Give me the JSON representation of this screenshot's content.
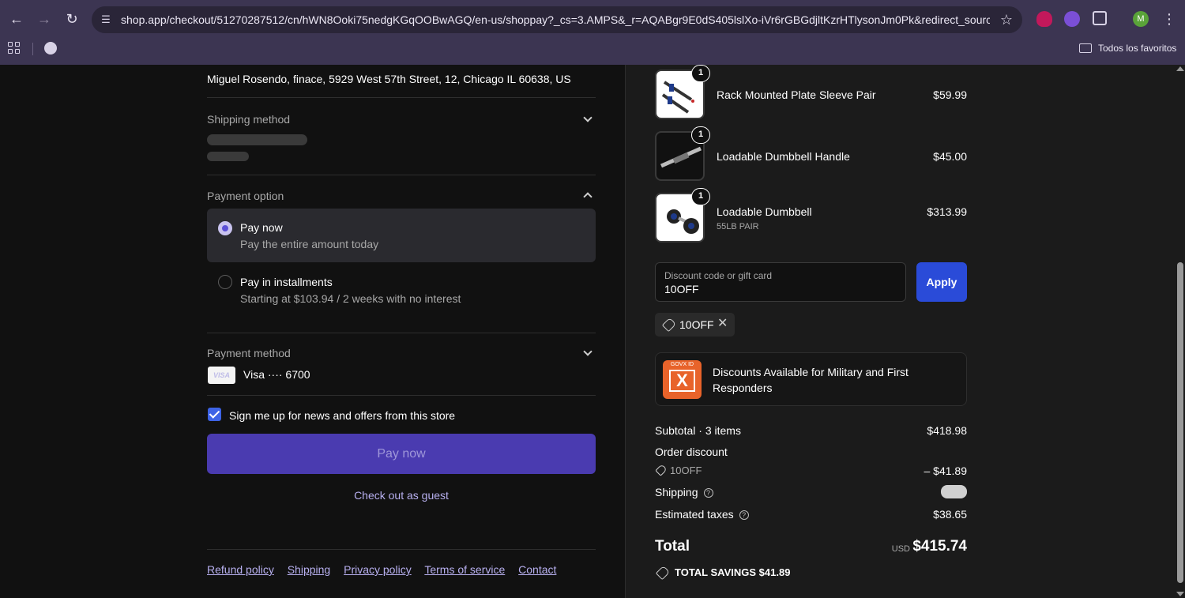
{
  "browser": {
    "url": "shop.app/checkout/51270287512/cn/hWN8Ooki75nedgKGqOOBwAGQ/en-us/shoppay?_cs=3.AMPS&_r=AQABgr9E0dS405lslXo-iVr6rGBGdjltKzrHTlysonJm0Pk&redirect_source=ch...",
    "avatar_letter": "M",
    "bookmarks_folder": "Todos los favoritos"
  },
  "checkout": {
    "address": "Miguel Rosendo, finace, 5929 West 57th Street, 12, Chicago IL 60638, US",
    "shipping_method_title": "Shipping method",
    "payment_option_title": "Payment option",
    "options": [
      {
        "title": "Pay now",
        "subtitle": "Pay the entire amount today"
      },
      {
        "title": "Pay in installments",
        "subtitle": "Starting at $103.94 / 2 weeks with no interest"
      }
    ],
    "payment_method_title": "Payment method",
    "card_brand": "VISA",
    "card_text": "Visa ···· 6700",
    "newsletter_label": "Sign me up for news and offers from this store",
    "pay_button": "Pay now",
    "guest_link": "Check out as guest",
    "footer_links": [
      "Refund policy",
      "Shipping",
      "Privacy policy",
      "Terms of service",
      "Contact"
    ]
  },
  "order": {
    "items": [
      {
        "name": "Rack Mounted Plate Sleeve Pair",
        "variant": "",
        "qty": "1",
        "price": "$59.99"
      },
      {
        "name": "Loadable Dumbbell Handle",
        "variant": "",
        "qty": "1",
        "price": "$45.00"
      },
      {
        "name": "Loadable Dumbbell",
        "variant": "55LB PAIR",
        "qty": "1",
        "price": "$313.99"
      }
    ],
    "discount_placeholder": "Discount code or gift card",
    "discount_value": "10OFF",
    "apply_button": "Apply",
    "applied_code": "10OFF",
    "promo_brand": "GOVX ID",
    "promo_text": "Discounts Available for Military and First Responders",
    "subtotal_label": "Subtotal · 3 items",
    "subtotal_value": "$418.98",
    "order_discount_label": "Order discount",
    "discount_code": "10OFF",
    "discount_amount": "– $41.89",
    "shipping_label": "Shipping",
    "taxes_label": "Estimated taxes",
    "taxes_value": "$38.65",
    "total_label": "Total",
    "total_currency": "USD",
    "total_value": "$415.74",
    "savings_text": "TOTAL SAVINGS  $41.89"
  },
  "colors": {
    "chrome": "#3c3552",
    "accent_button": "#4a3bb0",
    "apply_button": "#2a4bd8",
    "link": "#b8b0f0"
  }
}
